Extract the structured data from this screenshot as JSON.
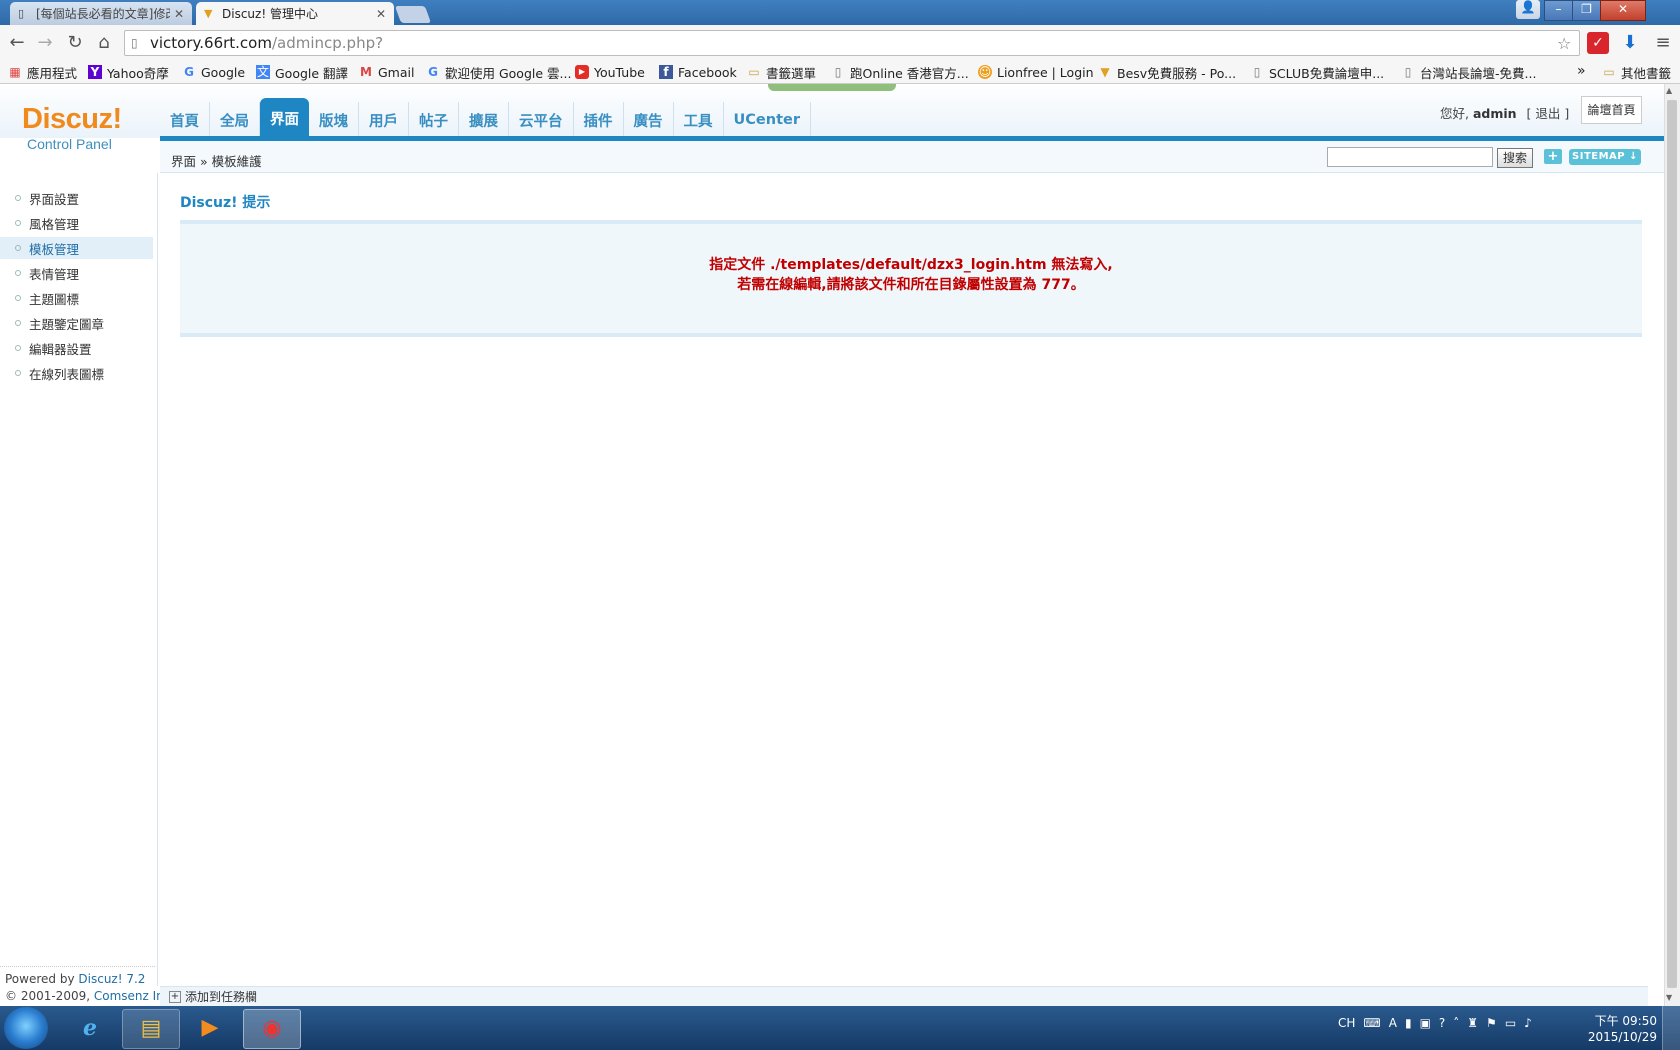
{
  "browser": {
    "tabs": [
      {
        "title": "[每個站長必看的文章]修改",
        "icon": "page-icon"
      },
      {
        "title": "Discuz! 管理中心",
        "icon": "discuz-favicon"
      }
    ],
    "url_host": "victory.66rt.com",
    "url_path": "/admincp.php?",
    "bookmarks": [
      {
        "label": "應用程式",
        "icon": "apps-icon"
      },
      {
        "label": "Yahoo奇摩",
        "icon": "yahoo-icon"
      },
      {
        "label": "Google",
        "icon": "google-icon"
      },
      {
        "label": "Google 翻譯",
        "icon": "translate-icon"
      },
      {
        "label": "Gmail",
        "icon": "gmail-icon"
      },
      {
        "label": "歡迎使用 Google 雲...",
        "icon": "google-icon"
      },
      {
        "label": "YouTube",
        "icon": "youtube-icon"
      },
      {
        "label": "Facebook",
        "icon": "facebook-icon"
      },
      {
        "label": "書籤選單",
        "icon": "folder-icon"
      },
      {
        "label": "跑Online 香港官方...",
        "icon": "page-icon"
      },
      {
        "label": "Lionfree | Login",
        "icon": "lionfree-icon"
      },
      {
        "label": "Besv免費服務 - Po...",
        "icon": "besv-icon"
      },
      {
        "label": "SCLUB免費論壇申...",
        "icon": "page-icon"
      },
      {
        "label": "台灣站長論壇-免費...",
        "icon": "page-icon"
      }
    ],
    "bookmarks_more": "»",
    "other_bookmarks": "其他書籤"
  },
  "header": {
    "logo": "Discuz!",
    "logo_sub": "Control Panel",
    "nav": [
      "首頁",
      "全局",
      "界面",
      "版塊",
      "用戶",
      "帖子",
      "擴展",
      "云平台",
      "插件",
      "廣告",
      "工具",
      "UCenter"
    ],
    "active_nav": "界面",
    "greeting": "您好,",
    "username": "admin",
    "logout": "[ 退出 ]",
    "forum_home": "論壇首頁"
  },
  "breadcrumb": {
    "section": "界面",
    "sep": "»",
    "page": "模板維護"
  },
  "search": {
    "button": "搜索",
    "add": "+",
    "sitemap": "SITEMAP ↓"
  },
  "sidebar": {
    "items": [
      {
        "label": "界面設置"
      },
      {
        "label": "風格管理"
      },
      {
        "label": "模板管理",
        "active": true
      },
      {
        "label": "表情管理"
      },
      {
        "label": "主題圖標"
      },
      {
        "label": "主題鑒定圖章"
      },
      {
        "label": "編輯器設置"
      },
      {
        "label": "在線列表圖標"
      }
    ],
    "powered_by": "Powered by",
    "powered_link": "Discuz! 7.2",
    "copyright": "© 2001-2009,",
    "company": "Comsenz Inc."
  },
  "main": {
    "title": "Discuz! 提示",
    "message_line1": "指定文件 ./templates/default/dzx3_login.htm 無法寫入,",
    "message_line2": "若需在線編輯,請將該文件和所在目錄屬性設置為 777。"
  },
  "footer": {
    "add_to_taskbar": "添加到任務欄"
  },
  "taskbar": {
    "clock_time": "下午 09:50",
    "clock_date": "2015/10/29",
    "lang": "CH"
  },
  "colors": {
    "accent": "#1e86c2",
    "logo": "#f08a1c",
    "error_text": "#c00000"
  }
}
